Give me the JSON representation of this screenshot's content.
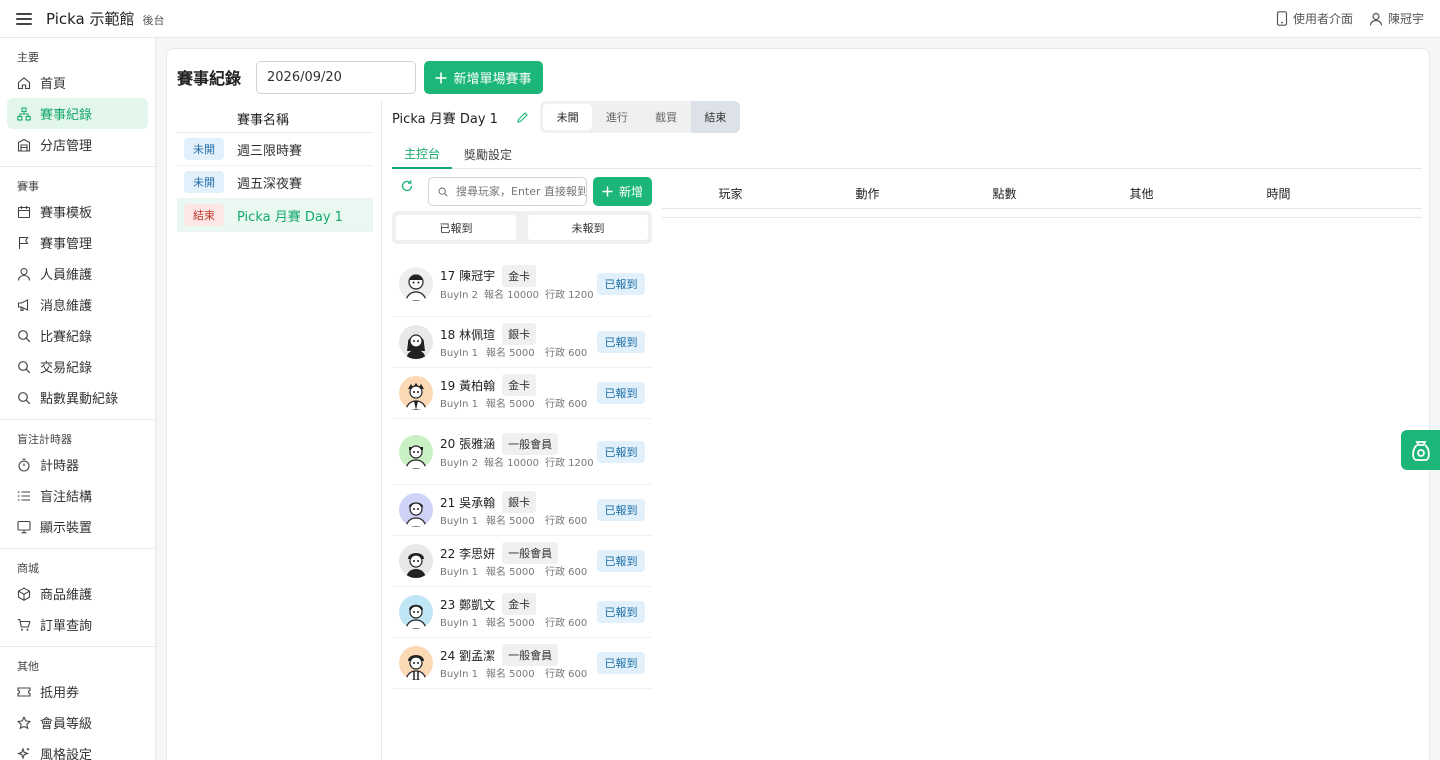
{
  "topbar": {
    "brand": "Picka 示範館",
    "brand_sub": "後台",
    "user_ui_label": "使用者介面",
    "username": "陳冠宇"
  },
  "sidebar": {
    "sections": [
      {
        "title": "主要",
        "items": [
          {
            "label": "首頁",
            "icon": "home-icon"
          },
          {
            "label": "賽事紀錄",
            "icon": "sitemap-icon",
            "active": true
          },
          {
            "label": "分店管理",
            "icon": "building-icon"
          }
        ]
      },
      {
        "title": "賽事",
        "items": [
          {
            "label": "賽事模板",
            "icon": "calendar-icon"
          },
          {
            "label": "賽事管理",
            "icon": "flag-icon"
          },
          {
            "label": "人員維護",
            "icon": "user-icon"
          },
          {
            "label": "消息維護",
            "icon": "megaphone-icon"
          },
          {
            "label": "比賽紀錄",
            "icon": "search-icon"
          },
          {
            "label": "交易紀錄",
            "icon": "search-icon"
          },
          {
            "label": "點數異動紀錄",
            "icon": "search-icon"
          }
        ]
      },
      {
        "title": "盲注計時器",
        "items": [
          {
            "label": "計時器",
            "icon": "stopwatch-icon"
          },
          {
            "label": "盲注結構",
            "icon": "list-icon"
          },
          {
            "label": "顯示裝置",
            "icon": "monitor-icon"
          }
        ]
      },
      {
        "title": "商城",
        "items": [
          {
            "label": "商品維護",
            "icon": "box-icon"
          },
          {
            "label": "訂單查詢",
            "icon": "cart-icon"
          }
        ]
      },
      {
        "title": "其他",
        "items": [
          {
            "label": "抵用券",
            "icon": "ticket-icon"
          },
          {
            "label": "會員等級",
            "icon": "star-icon"
          },
          {
            "label": "風格設定",
            "icon": "sparkle-icon"
          }
        ]
      }
    ]
  },
  "main": {
    "title": "賽事紀錄",
    "date_value": "2026/09/20",
    "add_event_label": "新增單場賽事",
    "event_list": {
      "header": "賽事名稱",
      "rows": [
        {
          "status": "未開",
          "name": "週三限時賽",
          "status_kind": "blue"
        },
        {
          "status": "未開",
          "name": "週五深夜賽",
          "status_kind": "blue"
        },
        {
          "status": "結束",
          "name": "Picka 月賽 Day 1",
          "status_kind": "red",
          "active": true
        }
      ]
    },
    "detail": {
      "title": "Picka 月賽 Day 1",
      "statuses": [
        "未開",
        "進行",
        "截買",
        "結束"
      ],
      "tabs": [
        "主控台",
        "獎勵設定"
      ],
      "search_placeholder": "搜尋玩家，Enter 直接報到",
      "add_player_label": "新增",
      "checkin_tabs": [
        "已報到",
        "未報到"
      ],
      "players": [
        {
          "no": "17",
          "name": "陳冠宇",
          "level": "金卡",
          "buyin": "BuyIn 2",
          "reg": "報名 10000",
          "admin": "行政 1200",
          "status": "已報到",
          "avatar_color": "#eeeeee",
          "tall": true
        },
        {
          "no": "18",
          "name": "林佩瑄",
          "level": "銀卡",
          "buyin": "BuyIn 1",
          "reg": "報名 5000",
          "admin": "行政 600",
          "status": "已報到",
          "avatar_color": "#e8e8e8"
        },
        {
          "no": "19",
          "name": "黃柏翰",
          "level": "金卡",
          "buyin": "BuyIn 1",
          "reg": "報名 5000",
          "admin": "行政 600",
          "status": "已報到",
          "avatar_color": "#fbd9b4"
        },
        {
          "no": "20",
          "name": "張雅涵",
          "level": "一般會員",
          "buyin": "BuyIn 2",
          "reg": "報名 10000",
          "admin": "行政 1200",
          "status": "已報到",
          "avatar_color": "#c9f0c4",
          "tall": true
        },
        {
          "no": "21",
          "name": "吳承翰",
          "level": "銀卡",
          "buyin": "BuyIn 1",
          "reg": "報名 5000",
          "admin": "行政 600",
          "status": "已報到",
          "avatar_color": "#cfd3f7"
        },
        {
          "no": "22",
          "name": "李思妍",
          "level": "一般會員",
          "buyin": "BuyIn 1",
          "reg": "報名 5000",
          "admin": "行政 600",
          "status": "已報到",
          "avatar_color": "#e8e8e8"
        },
        {
          "no": "23",
          "name": "鄭凱文",
          "level": "金卡",
          "buyin": "BuyIn 1",
          "reg": "報名 5000",
          "admin": "行政 600",
          "status": "已報到",
          "avatar_color": "#bfe6f5"
        },
        {
          "no": "24",
          "name": "劉孟潔",
          "level": "一般會員",
          "buyin": "BuyIn 1",
          "reg": "報名 5000",
          "admin": "行政 600",
          "status": "已報到",
          "avatar_color": "#fbd9b4"
        }
      ],
      "log_columns": [
        "玩家",
        "動作",
        "點數",
        "其他",
        "時間"
      ]
    }
  },
  "colors": {
    "accent": "#1cb678",
    "accent_text": "#17a86b",
    "badge_blue_bg": "#e1f0fb",
    "badge_red_bg": "#fde6e6"
  }
}
